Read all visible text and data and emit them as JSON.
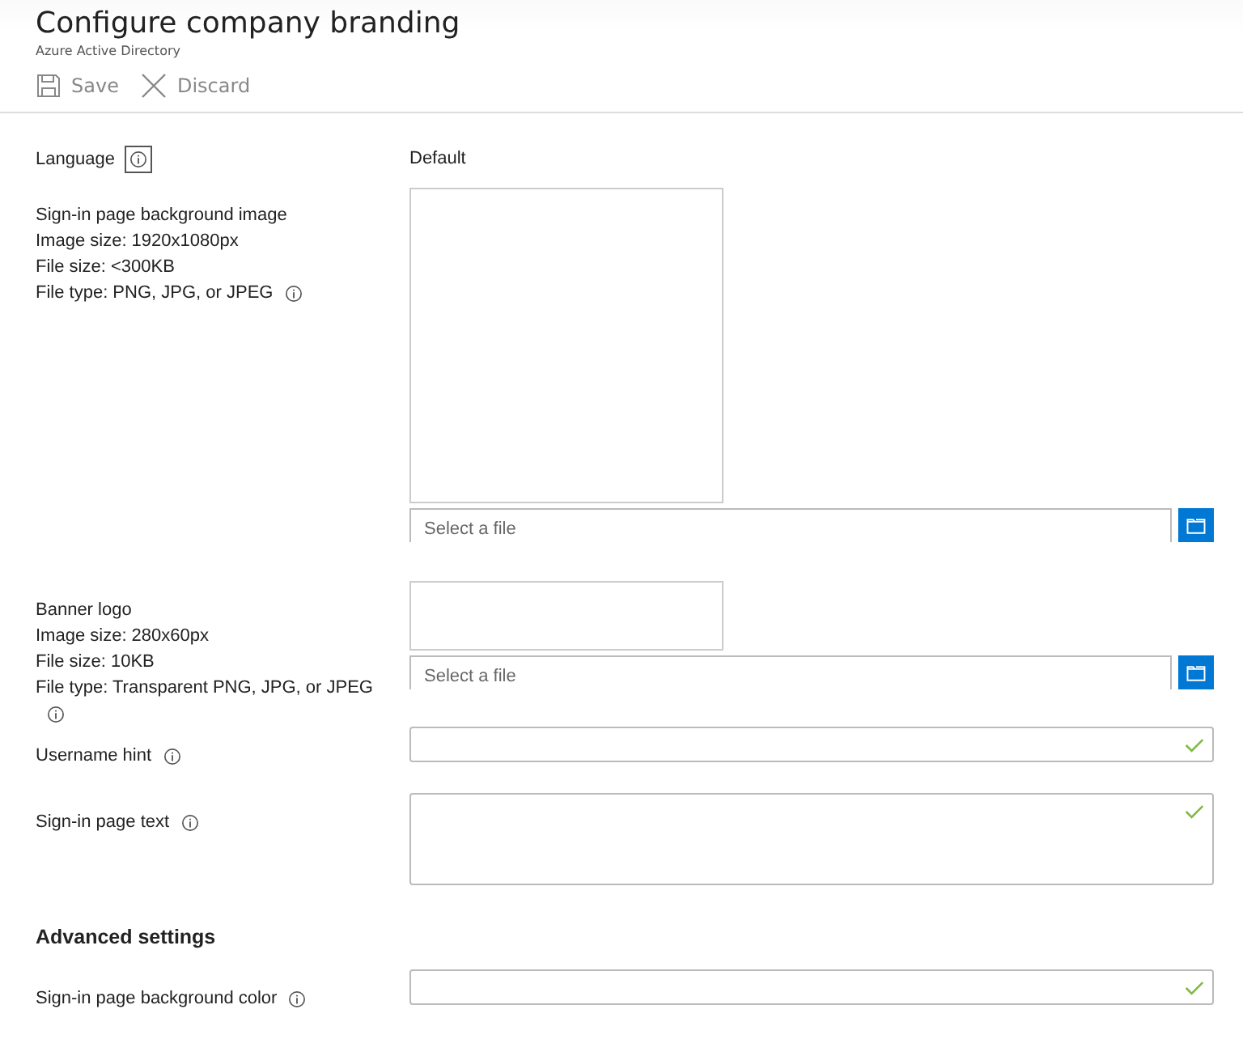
{
  "header": {
    "title": "Configure company branding",
    "subtitle": "Azure Active Directory"
  },
  "toolbar": [
    {
      "kind": "save",
      "label": "Save",
      "disabled": true
    },
    {
      "kind": "discard",
      "label": "Discard",
      "disabled": true
    }
  ],
  "rows": [
    {
      "kind": "text",
      "label": [
        "Language"
      ],
      "info": true,
      "info_focused": true,
      "value": "Default"
    },
    {
      "kind": "background-upload",
      "label": [
        "Sign-in page background image",
        "Image size: 1920x1080px",
        "File size: <300KB",
        "File type: PNG, JPG, or JPEG"
      ],
      "info": true,
      "info_focused": false,
      "placeholder": "Select a file"
    },
    {
      "kind": "logo-upload",
      "label": [
        "Banner logo",
        "Image size: 280x60px",
        "File size: 10KB",
        "File type: Transparent PNG, JPG, or JPEG"
      ],
      "info": true,
      "info_focused": false,
      "placeholder": "Select a file"
    },
    {
      "kind": "input",
      "label": [
        "Username hint"
      ],
      "info": true,
      "info_focused": false,
      "valid": true
    },
    {
      "kind": "textarea",
      "label": [
        "Sign-in page text"
      ],
      "info": true,
      "info_focused": false,
      "valid": true
    },
    {
      "kind": "heading",
      "label": [
        "Advanced settings"
      ]
    },
    {
      "kind": "input",
      "label": [
        "Sign-in page background color"
      ],
      "info": true,
      "info_focused": false,
      "valid": true
    }
  ]
}
